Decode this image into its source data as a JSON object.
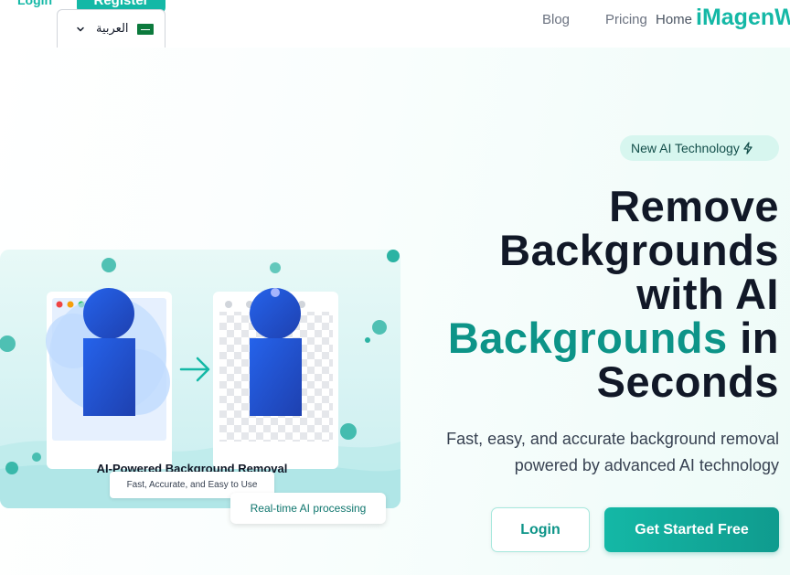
{
  "header": {
    "login": "Login",
    "register": "Register",
    "language": "العربية",
    "nav": {
      "blog": "Blog",
      "pricing": "Pricing",
      "home": "Home"
    },
    "logo": "iMagenW"
  },
  "hero": {
    "badge": "New AI Technology",
    "headline_line1": "Remove",
    "headline_line2": "Backgrounds",
    "headline_line3": "with AI",
    "headline_accent": "Backgrounds",
    "headline_line4_tail": "in",
    "headline_line5": "Seconds",
    "subtext": "Fast, easy, and accurate background removal powered by advanced AI technology",
    "login_button": "Login",
    "cta_button": "Get Started Free"
  },
  "illustration": {
    "title": "AI-Powered Background Removal",
    "subtitle": "Fast, Accurate, and Easy to Use",
    "badge": "Real-time AI processing"
  },
  "colors": {
    "brand": "#14b8a6",
    "accent_dark": "#0d9488",
    "figure_blue": "#1d4ed8"
  }
}
